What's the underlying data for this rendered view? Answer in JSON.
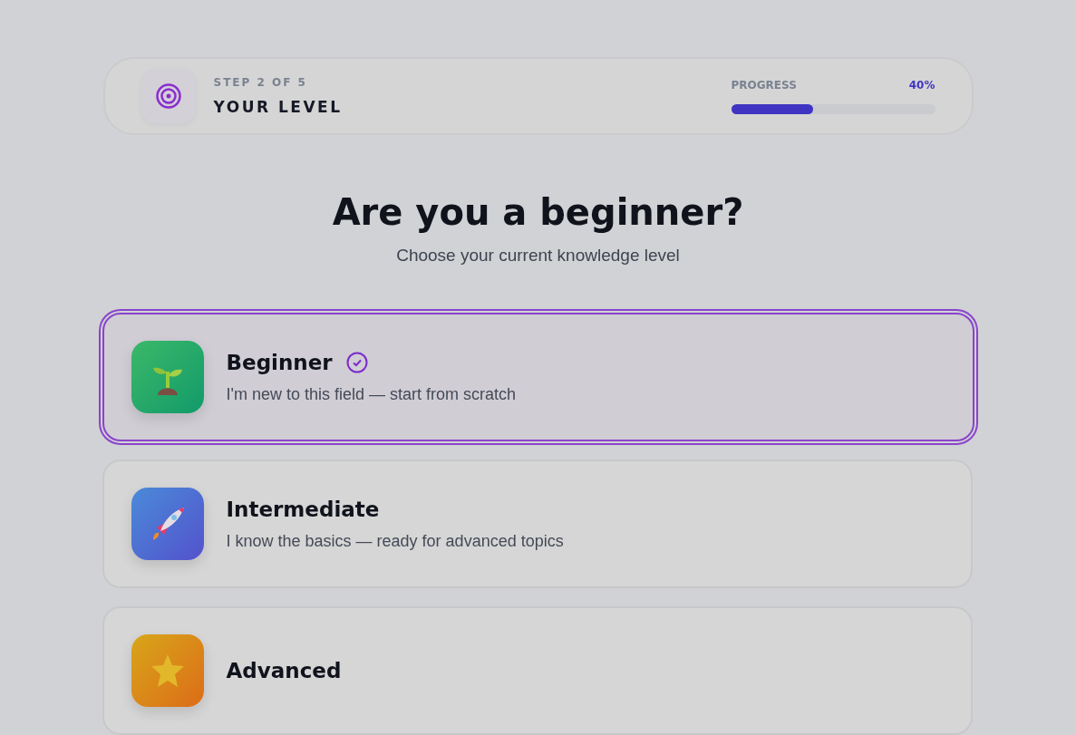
{
  "header": {
    "step": "STEP 2 OF 5",
    "title": "YOUR LEVEL",
    "progress_label": "PROGRESS",
    "progress_value": "40%",
    "level": 0.4
  },
  "heading": "Are you a beginner?",
  "subheading": "Choose your current knowledge level",
  "options": [
    {
      "kind": "sprout",
      "title": "Beginner",
      "description": "I'm new to this field — start from scratch",
      "selected": true
    },
    {
      "kind": "rocket",
      "title": "Intermediate",
      "description": "I know the basics — ready for advanced topics",
      "selected": false
    },
    {
      "kind": "star",
      "title": "Advanced",
      "selected": false
    }
  ]
}
